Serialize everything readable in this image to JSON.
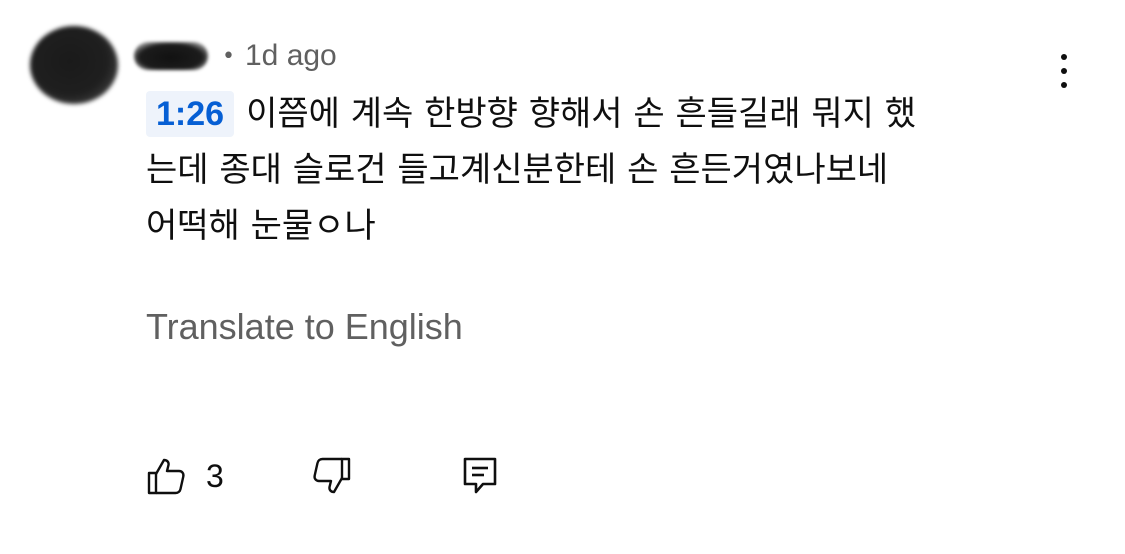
{
  "comment": {
    "author": "",
    "separator": "•",
    "time": "1d ago",
    "timestamp_link": "1:26",
    "text_line1": "이쯤에 계속 한방향 향해서 손 흔들길래 뭐지 했",
    "text_line2": "는데 종대 슬로건 들고계신분한테 손 흔든거였나보네",
    "text_line3": "어떡해 눈물ㅇ나",
    "translate_label": "Translate to English",
    "like_count": "3"
  },
  "icons": {
    "menu": "more-vertical-icon",
    "like": "thumbs-up-icon",
    "dislike": "thumbs-down-icon",
    "reply": "comment-reply-icon"
  },
  "colors": {
    "timestamp_link": "#065fd4",
    "timestamp_bg": "#eef3fb",
    "secondary_text": "#606060",
    "primary_text": "#0f0f0f"
  }
}
